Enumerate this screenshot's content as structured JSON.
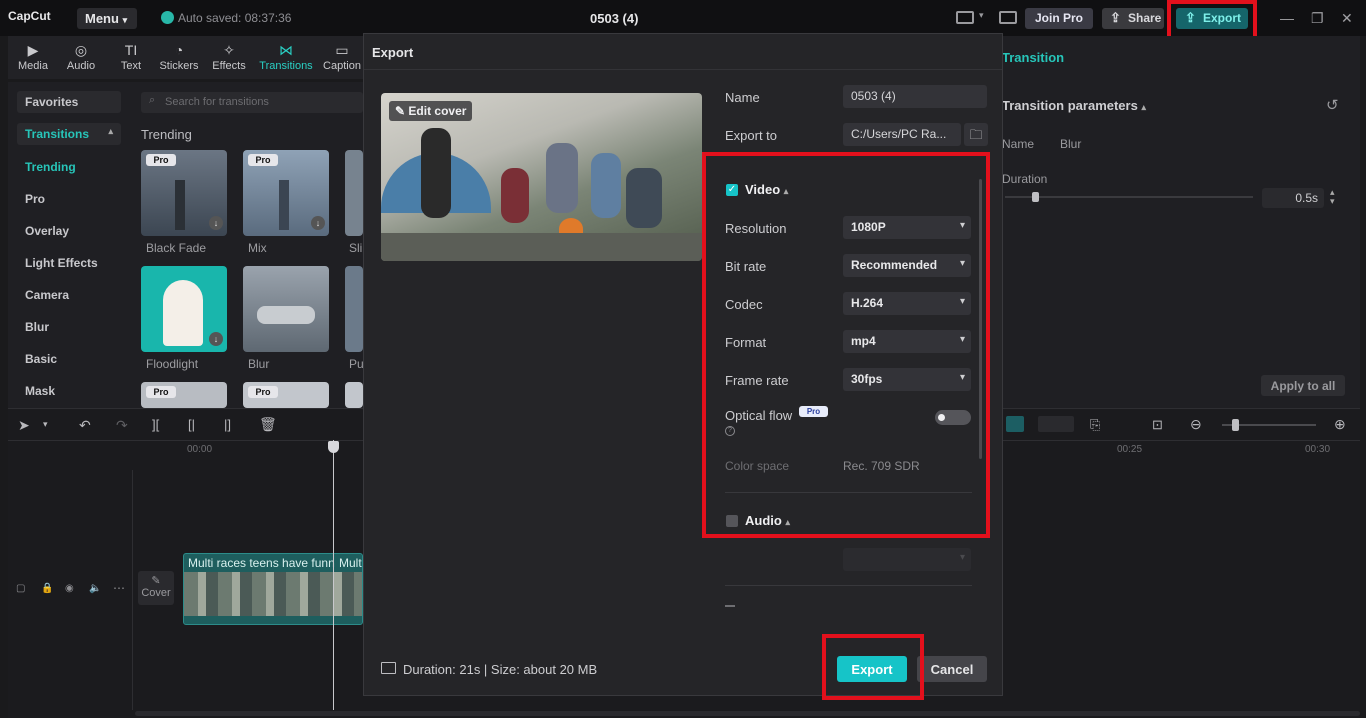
{
  "titlebar": {
    "logo": "CapCut",
    "menu_label": "Menu",
    "autosave": "Auto saved: 08:37:36",
    "project_title": "0503 (4)",
    "join_pro": "Join Pro",
    "share": "Share",
    "export": "Export"
  },
  "toolbar": {
    "items": [
      {
        "label": "Media",
        "icon": "▶"
      },
      {
        "label": "Audio",
        "icon": "◎"
      },
      {
        "label": "Text",
        "icon": "TI"
      },
      {
        "label": "Stickers",
        "icon": "◔"
      },
      {
        "label": "Effects",
        "icon": "✧"
      },
      {
        "label": "Transitions",
        "icon": "⋈"
      },
      {
        "label": "Caption",
        "icon": "▭"
      }
    ]
  },
  "leftnav": {
    "favorites": "Favorites",
    "transitions": "Transitions",
    "items": [
      "Trending",
      "Pro",
      "Overlay",
      "Light Effects",
      "Camera",
      "Blur",
      "Basic",
      "Mask"
    ]
  },
  "gallery": {
    "search_placeholder": "Search for transitions",
    "section": "Trending",
    "pro_badge": "Pro",
    "thumbs": [
      "Black Fade",
      "Mix",
      "Sli",
      "Floodlight",
      "Blur",
      "Pu"
    ]
  },
  "rightpanel": {
    "tab": "Transition",
    "params_title": "Transition parameters",
    "name_label": "Name",
    "name_value": "Blur",
    "duration_label": "Duration",
    "duration_value": "0.5s",
    "apply_all": "Apply to all",
    "slider_level": 0.12
  },
  "timeline": {
    "ruler_start": "00:00",
    "ruler_mid": "00:25",
    "ruler_end": "00:30",
    "cover_label": "Cover",
    "clip_title": "Multi races teens have funn",
    "clip_title2": "Mult"
  },
  "modal": {
    "title": "Export",
    "edit_cover": "Edit cover",
    "name_label": "Name",
    "name_value": "0503 (4)",
    "export_to_label": "Export to",
    "export_to_value": "C:/Users/PC Ra...",
    "video_section": "Video",
    "resolution_label": "Resolution",
    "resolution_value": "1080P",
    "bitrate_label": "Bit rate",
    "bitrate_value": "Recommended",
    "codec_label": "Codec",
    "codec_value": "H.264",
    "format_label": "Format",
    "format_value": "mp4",
    "framerate_label": "Frame rate",
    "framerate_value": "30fps",
    "optical_flow_label": "Optical flow",
    "pro_badge": "Pro",
    "colorspace_label": "Color space",
    "colorspace_value": "Rec. 709 SDR",
    "audio_section": "Audio",
    "footer_info": "Duration: 21s | Size: about 20 MB",
    "export_button": "Export",
    "cancel_button": "Cancel"
  },
  "colors": {
    "accent": "#16c4c8",
    "highlight_box": "#e3101c",
    "background": "#1a1a1c"
  }
}
